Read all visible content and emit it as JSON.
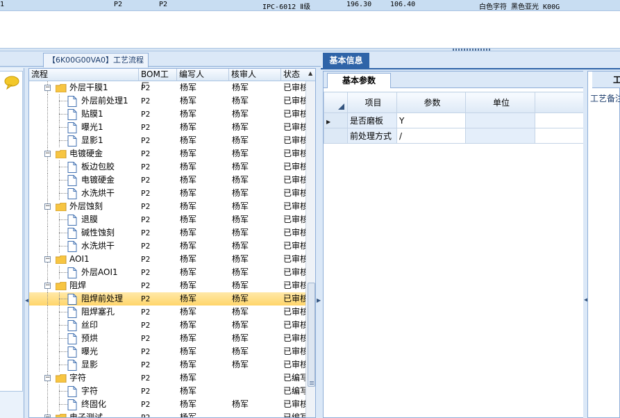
{
  "top_row": {
    "c0": "1",
    "c1": "P2",
    "c2": "P2",
    "c3": "IPC-6012 Ⅱ级",
    "c4": "196.30",
    "c5": "106.40",
    "c6": "白色字符  黑色亚光  K00G"
  },
  "left": {
    "tab_label": "【6K00G00VA0】工艺流程",
    "columns": [
      "流程",
      "BOM工厂",
      "编写人",
      "核审人",
      "状态"
    ],
    "rows": [
      {
        "level": 0,
        "label": "外层干膜1",
        "bom": "P2",
        "writer": "杨军",
        "reviewer": "杨军",
        "status": "已审核"
      },
      {
        "level": 1,
        "label": "外层前处理1",
        "bom": "P2",
        "writer": "杨军",
        "reviewer": "杨军",
        "status": "已审核"
      },
      {
        "level": 1,
        "label": "贴膜1",
        "bom": "P2",
        "writer": "杨军",
        "reviewer": "杨军",
        "status": "已审核"
      },
      {
        "level": 1,
        "label": "曝光1",
        "bom": "P2",
        "writer": "杨军",
        "reviewer": "杨军",
        "status": "已审核"
      },
      {
        "level": 1,
        "label": "显影1",
        "bom": "P2",
        "writer": "杨军",
        "reviewer": "杨军",
        "status": "已审核"
      },
      {
        "level": 0,
        "label": "电镀硬金",
        "bom": "P2",
        "writer": "杨军",
        "reviewer": "杨军",
        "status": "已审核"
      },
      {
        "level": 1,
        "label": "板边包胶",
        "bom": "P2",
        "writer": "杨军",
        "reviewer": "杨军",
        "status": "已审核"
      },
      {
        "level": 1,
        "label": "电镀硬金",
        "bom": "P2",
        "writer": "杨军",
        "reviewer": "杨军",
        "status": "已审核"
      },
      {
        "level": 1,
        "label": "水洗烘干",
        "bom": "P2",
        "writer": "杨军",
        "reviewer": "杨军",
        "status": "已审核"
      },
      {
        "level": 0,
        "label": "外层蚀刻",
        "bom": "P2",
        "writer": "杨军",
        "reviewer": "杨军",
        "status": "已审核"
      },
      {
        "level": 1,
        "label": "退膜",
        "bom": "P2",
        "writer": "杨军",
        "reviewer": "杨军",
        "status": "已审核"
      },
      {
        "level": 1,
        "label": "碱性蚀刻",
        "bom": "P2",
        "writer": "杨军",
        "reviewer": "杨军",
        "status": "已审核"
      },
      {
        "level": 1,
        "label": "水洗烘干",
        "bom": "P2",
        "writer": "杨军",
        "reviewer": "杨军",
        "status": "已审核"
      },
      {
        "level": 0,
        "label": "AOI1",
        "bom": "P2",
        "writer": "杨军",
        "reviewer": "杨军",
        "status": "已审核"
      },
      {
        "level": 1,
        "label": "外层AOI1",
        "bom": "P2",
        "writer": "杨军",
        "reviewer": "杨军",
        "status": "已审核"
      },
      {
        "level": 0,
        "label": "阻焊",
        "bom": "P2",
        "writer": "杨军",
        "reviewer": "杨军",
        "status": "已审核"
      },
      {
        "level": 1,
        "label": "阻焊前处理",
        "bom": "P2",
        "writer": "杨军",
        "reviewer": "杨军",
        "status": "已审核",
        "selected": true
      },
      {
        "level": 1,
        "label": "阻焊塞孔",
        "bom": "P2",
        "writer": "杨军",
        "reviewer": "杨军",
        "status": "已审核"
      },
      {
        "level": 1,
        "label": "丝印",
        "bom": "P2",
        "writer": "杨军",
        "reviewer": "杨军",
        "status": "已审核"
      },
      {
        "level": 1,
        "label": "预烘",
        "bom": "P2",
        "writer": "杨军",
        "reviewer": "杨军",
        "status": "已审核"
      },
      {
        "level": 1,
        "label": "曝光",
        "bom": "P2",
        "writer": "杨军",
        "reviewer": "杨军",
        "status": "已审核"
      },
      {
        "level": 1,
        "label": "显影",
        "bom": "P2",
        "writer": "杨军",
        "reviewer": "杨军",
        "status": "已审核"
      },
      {
        "level": 0,
        "label": "字符",
        "bom": "P2",
        "writer": "杨军",
        "reviewer": "",
        "status": "已编写"
      },
      {
        "level": 1,
        "label": "字符",
        "bom": "P2",
        "writer": "杨军",
        "reviewer": "",
        "status": "已编写"
      },
      {
        "level": 1,
        "label": "终固化",
        "bom": "P2",
        "writer": "杨军",
        "reviewer": "杨军",
        "status": "已审核"
      },
      {
        "level": 0,
        "label": "电子测试",
        "bom": "P2",
        "writer": "杨军",
        "reviewer": "",
        "status": "已编写"
      }
    ]
  },
  "right": {
    "tab_label": "基本信息",
    "inner_tab_label": "基本参数",
    "grid_columns": [
      "项目",
      "参数",
      "单位"
    ],
    "grid_rows": [
      {
        "item": "是否磨板",
        "param": "Y",
        "unit": ""
      },
      {
        "item": "前处理方式",
        "param": "/",
        "unit": ""
      }
    ],
    "far_tab_label": "工",
    "far_label": "工艺备注"
  },
  "colors": {
    "accent": "#2f64a8",
    "selected_row": "#ffd56a",
    "panel_bg": "#dbe8f7"
  }
}
